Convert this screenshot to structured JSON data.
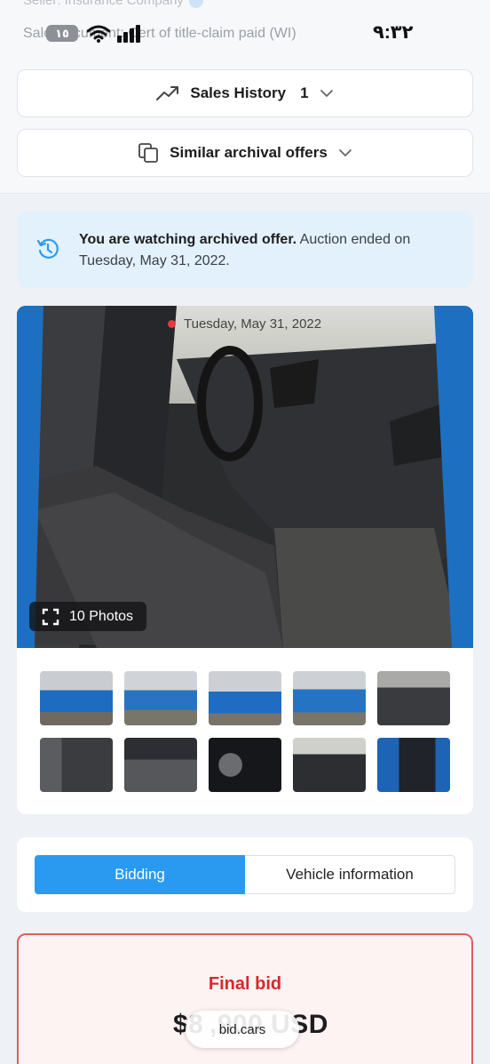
{
  "background": {
    "seller_text": "Seller:  Insurance Company",
    "sale_doc_text": "Sale Document: Cert of title-claim paid (WI)"
  },
  "status_bar": {
    "time": "٩:٣٢",
    "battery": "١٥"
  },
  "sales_history": {
    "label": "Sales History",
    "count": "1",
    "icon": "trending-up-icon"
  },
  "similar_offers": {
    "label": "Similar archival offers",
    "icon": "copy-icon"
  },
  "notice": {
    "bold_text": "You are watching archived offer.",
    "text": " Auction ended on Tuesday, May 31, 2022.",
    "icon": "history-icon"
  },
  "gallery": {
    "date": "Tuesday, May 31, 2022",
    "photos_label": "10 Photos",
    "thumbnails": [
      "Front-left exterior",
      "Front damage",
      "Rear-left exterior",
      "Rear-right exterior",
      "Front seats",
      "Rear seats",
      "Engine bay",
      "Instrument cluster",
      "Dashboard",
      "Door label"
    ]
  },
  "tabs": {
    "active": "Bidding",
    "inactive": "Vehicle information"
  },
  "final_bid": {
    "label": "Final bid",
    "amount": "$8 ,900 USD"
  },
  "browser": {
    "url": "bid.cars"
  },
  "colors": {
    "accent": "#2a9af0",
    "danger": "#d9272c",
    "notice_bg": "#e3f1fc"
  }
}
